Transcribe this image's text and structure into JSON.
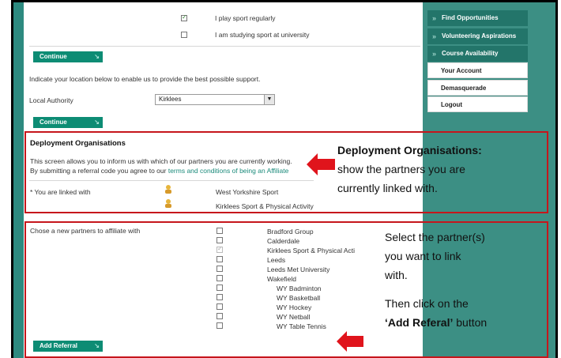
{
  "sport_options": [
    {
      "label": "I play sport regularly",
      "checked": true
    },
    {
      "label": "I am studying sport at university",
      "checked": false
    }
  ],
  "continue_label": "Continue",
  "location_prompt": "Indicate your location below to enable us to provide the best possible support.",
  "local_authority": {
    "label": "Local Authority",
    "value": "Kirklees"
  },
  "sidebar": {
    "items": [
      {
        "label": "Find Opportunities"
      },
      {
        "label": "Volunteering Aspirations"
      },
      {
        "label": "Course Availability"
      },
      {
        "label": "Your Account"
      },
      {
        "label": "Demasquerade"
      },
      {
        "label": "Logout"
      }
    ]
  },
  "deployment": {
    "heading": "Deployment Organisations",
    "description_line1": "This screen allows you to inform us with which of our partners you are currently working.",
    "description_line2_prefix": "By submitting a referral code you agree to our ",
    "terms_link": "terms and conditions of being an Affiliate",
    "linked_label": "* You are linked with",
    "linked": [
      "West Yorkshire Sport",
      "Kirklees Sport & Physical Activity"
    ]
  },
  "affiliate": {
    "label": "Chose a new partners to affiliate with",
    "partners": [
      {
        "name": "Bradford Group",
        "checked": false,
        "disabled": false
      },
      {
        "name": "Calderdale",
        "checked": false,
        "disabled": false
      },
      {
        "name": "Kirklees Sport & Physical Acti",
        "checked": true,
        "disabled": true
      },
      {
        "name": "Leeds",
        "checked": false,
        "disabled": false
      },
      {
        "name": "Leeds Met University",
        "checked": false,
        "disabled": false
      },
      {
        "name": "Wakefield",
        "checked": false,
        "disabled": false
      },
      {
        "name": "WY Badminton",
        "checked": false,
        "disabled": false
      },
      {
        "name": "WY Basketball",
        "checked": false,
        "disabled": false
      },
      {
        "name": "WY Hockey",
        "checked": false,
        "disabled": false
      },
      {
        "name": "WY Netball",
        "checked": false,
        "disabled": false
      },
      {
        "name": "WY Table Tennis",
        "checked": false,
        "disabled": false
      }
    ],
    "add_button": "Add Referral"
  },
  "callouts": {
    "deployment_title": "Deployment Organisations:",
    "deployment_line1": "show the partners you are",
    "deployment_line2": "currently linked with.",
    "select_line1": "Select the partner(s)",
    "select_line2": "you want to link",
    "select_line3": "with.",
    "then_line1": "Then click on the",
    "then_bold": "‘Add Referal’",
    "then_rest": " button"
  },
  "colors": {
    "accent_teal": "#0d8c74",
    "sidebar_bg": "#3c8f84",
    "highlight_red": "#c6161c"
  }
}
